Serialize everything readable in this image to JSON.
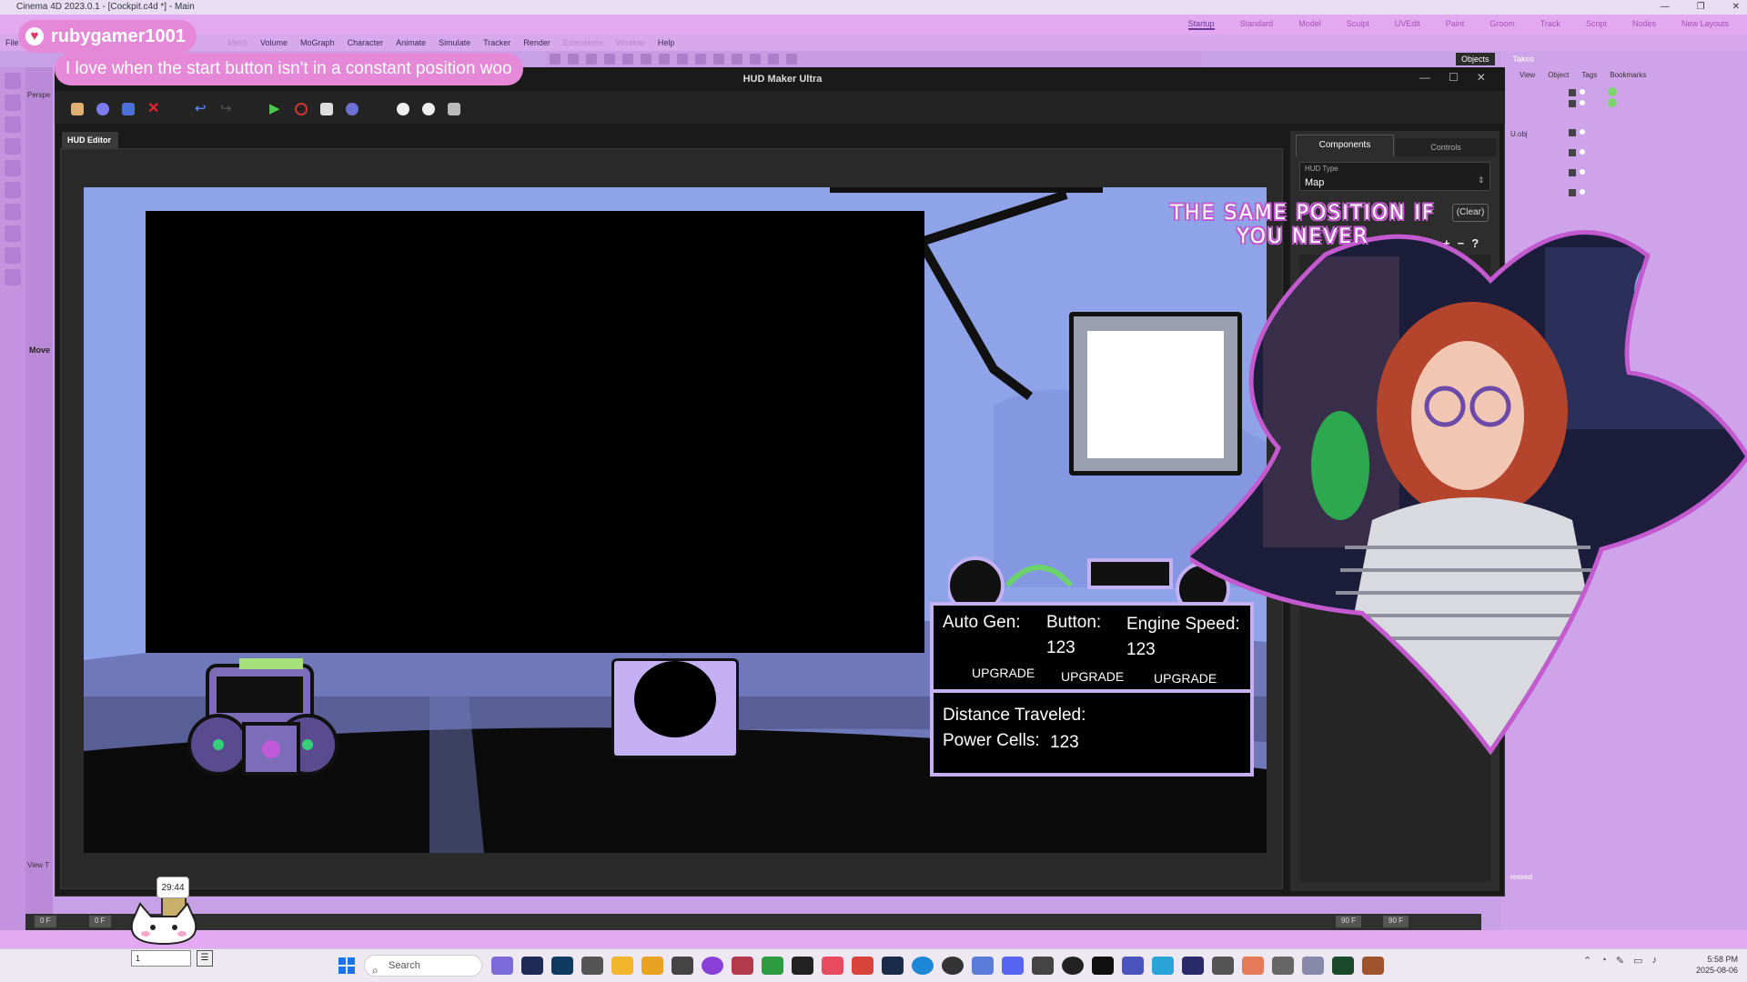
{
  "c4d": {
    "title": "Cinema 4D 2023.0.1 - [Cockpit.c4d *] - Main",
    "layouts": [
      "Startup",
      "Standard",
      "Model",
      "Sculpt",
      "UVEdit",
      "Paint",
      "Groom",
      "Track",
      "Script",
      "Nodes",
      "New Layouts"
    ],
    "file_menu": "File",
    "menus": [
      "Mesh",
      "Volume",
      "MoGraph",
      "Character",
      "Animate",
      "Simulate",
      "Tracker",
      "Render",
      "Extensions",
      "Window",
      "Help"
    ],
    "left_labels": {
      "persp": "Perspe",
      "move": "Move",
      "viewt": "View T"
    },
    "objects_tabs": [
      "Objects",
      "Takes"
    ],
    "objects_menu": [
      "View",
      "Object",
      "Tags",
      "Bookmarks"
    ],
    "obj_label": "U.obj",
    "pressed_label": "ressed",
    "timeline": {
      "start": "0 F",
      "current": "0 F",
      "end1": "90 F",
      "end2": "90 F"
    }
  },
  "hud": {
    "title": "HUD Maker Ultra",
    "editor_tab": "HUD Editor",
    "tabs": {
      "components": "Components",
      "controls": "Controls"
    },
    "hud_type_label": "HUD Type",
    "hud_type_value": "Map",
    "clear_label": "(Clear)",
    "add_label": "+",
    "remove_label": "−",
    "help_label": "?"
  },
  "game": {
    "auto_gen_label": "Auto Gen:",
    "button_label": "Button:",
    "button_value": "123",
    "engine_speed_label": "Engine Speed:",
    "engine_speed_value": "123",
    "upgrade_1": "UPGRADE",
    "upgrade_2": "UPGRADE",
    "upgrade_3": "UPGRADE",
    "distance_label": "Distance Traveled:",
    "power_cells_label": "Power Cells:",
    "power_cells_value": "123"
  },
  "overlay": {
    "chat_user": "rubygamer1001",
    "chat_message": "I love when the start button isn't in a constant position woo",
    "caption": "THE SAME POSITION IF YOU NEVER",
    "timer": "29:44"
  },
  "taskbar": {
    "search_placeholder": "Search",
    "time": "5:58 PM",
    "date": "2025-08-06",
    "mini_value": "1"
  },
  "colors": {
    "accent_pink": "#e688d8",
    "panel_lilac": "#c6b0f4",
    "c4d_purple": "#d7a9ec"
  }
}
